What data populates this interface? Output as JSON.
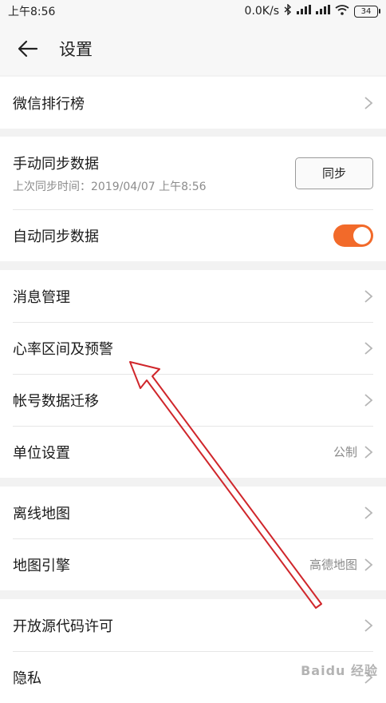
{
  "status_bar": {
    "time": "上午8:56",
    "speed": "0.0K/s",
    "battery": "34"
  },
  "header": {
    "title": "设置"
  },
  "sections": [
    {
      "items": [
        {
          "label": "微信排行榜"
        }
      ]
    },
    {
      "items": [
        {
          "label": "手动同步数据",
          "sub": "上次同步时间：2019/04/07 上午8:56",
          "button": "同步"
        },
        {
          "label": "自动同步数据",
          "toggle_on": true
        }
      ]
    },
    {
      "items": [
        {
          "label": "消息管理"
        },
        {
          "label": "心率区间及预警"
        },
        {
          "label": "帐号数据迁移"
        },
        {
          "label": "单位设置",
          "value": "公制"
        }
      ]
    },
    {
      "items": [
        {
          "label": "离线地图"
        },
        {
          "label": "地图引擎",
          "value": "高德地图"
        }
      ]
    },
    {
      "items": [
        {
          "label": "开放源代码许可"
        },
        {
          "label": "隐私"
        }
      ]
    }
  ],
  "watermark": "Baidu 经验",
  "colors": {
    "accent": "#f26a2a",
    "annotation_arrow": "#d0262b"
  }
}
